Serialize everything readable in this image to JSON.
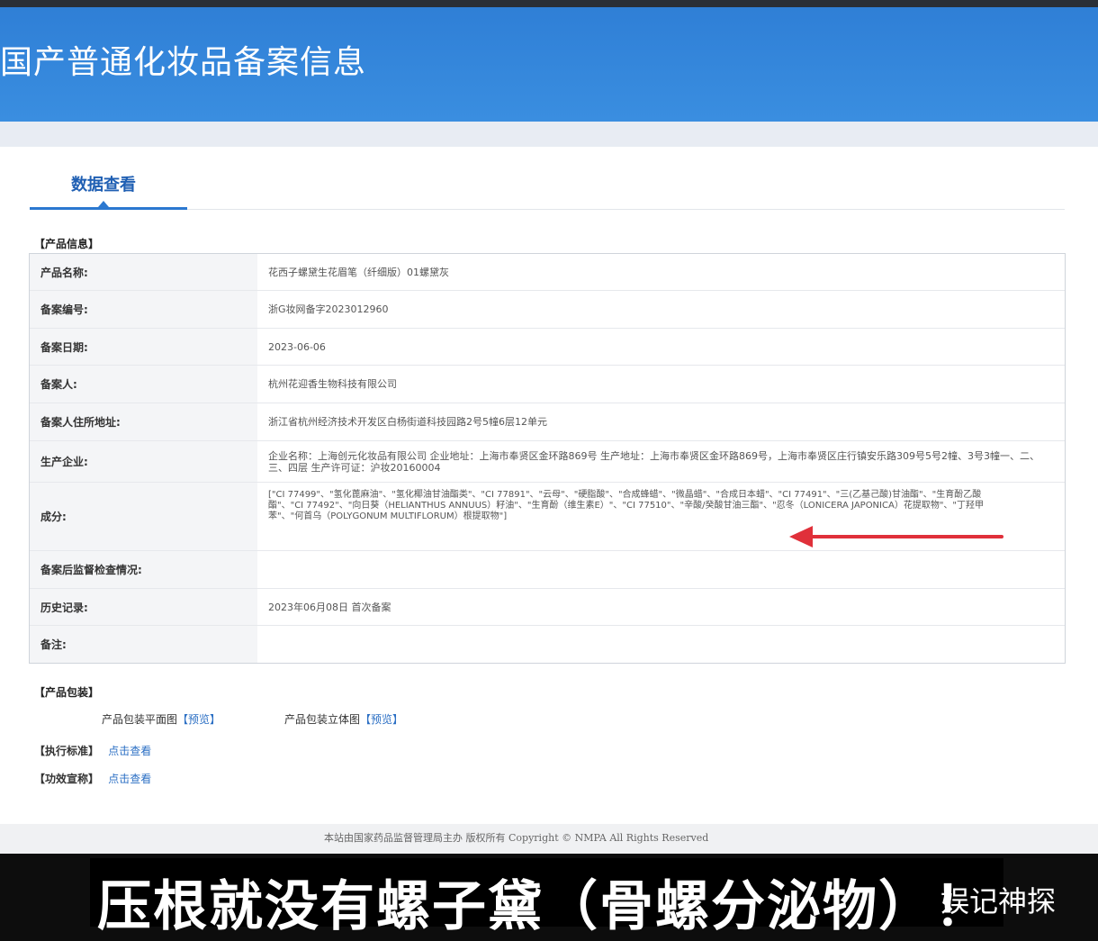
{
  "header": {
    "title": "国产普通化妆品备案信息"
  },
  "tab": {
    "label": "数据查看"
  },
  "product_info": {
    "section_title": "【产品信息】",
    "rows": [
      {
        "label": "产品名称:",
        "value": "花西子螺黛生花眉笔（纤细版）01螺黛灰"
      },
      {
        "label": "备案编号:",
        "value": "浙G妆网备字2023012960"
      },
      {
        "label": "备案日期:",
        "value": "2023-06-06"
      },
      {
        "label": "备案人:",
        "value": "杭州花迎香生物科技有限公司"
      },
      {
        "label": "备案人住所地址:",
        "value": "浙江省杭州经济技术开发区白杨街道科技园路2号5幢6层12单元"
      },
      {
        "label": "生产企业:",
        "value": "企业名称：上海创元化妆品有限公司 企业地址：上海市奉贤区金环路869号 生产地址：上海市奉贤区金环路869号，上海市奉贤区庄行镇安乐路309号5号2幢、3号3幢一、二、三、四层 生产许可证：沪妆20160004"
      },
      {
        "label": "成分:",
        "value": "[\"CI 77499\"、\"氢化蓖麻油\"、\"氢化椰油甘油酯类\"、\"CI 77891\"、\"云母\"、\"硬脂酸\"、\"合成蜂蜡\"、\"微晶蜡\"、\"合成日本蜡\"、\"CI 77491\"、\"三(乙基己酸)甘油酯\"、\"生育酚乙酸酯\"、\"CI 77492\"、\"向日葵（HELIANTHUS ANNUUS）籽油\"、\"生育酚（维生素E）\"、\"CI 77510\"、\"辛酸/癸酸甘油三酯\"、\"忍冬（LONICERA JAPONICA）花提取物\"、\"丁羟甲苯\"、\"何首乌（POLYGONUM MULTIFLORUM）根提取物\"]"
      },
      {
        "label": "备案后监督检查情况:",
        "value": ""
      },
      {
        "label": "历史记录:",
        "value": "2023年06月08日 首次备案"
      },
      {
        "label": "备注:",
        "value": ""
      }
    ]
  },
  "packaging": {
    "section_title": "【产品包装】",
    "flat_label": "产品包装平面图",
    "flat_link": "【预览】",
    "stereo_label": "产品包装立体图",
    "stereo_link": "【预览】"
  },
  "standard": {
    "label": "【执行标准】",
    "link": "点击查看"
  },
  "efficacy": {
    "label": "【功效宣称】",
    "link": "点击查看"
  },
  "footer": {
    "text": "本站由国家药品监督管理局主办 版权所有 Copyright © NMPA All Rights Reserved"
  },
  "caption": {
    "text": "压根就没有螺子黛（骨螺分泌物）！"
  },
  "watermark": {
    "text": "娱记神探"
  },
  "colors": {
    "header_blue": "#3a8ee0",
    "link_blue": "#2b6fc4",
    "arrow_red": "#e0303a"
  }
}
